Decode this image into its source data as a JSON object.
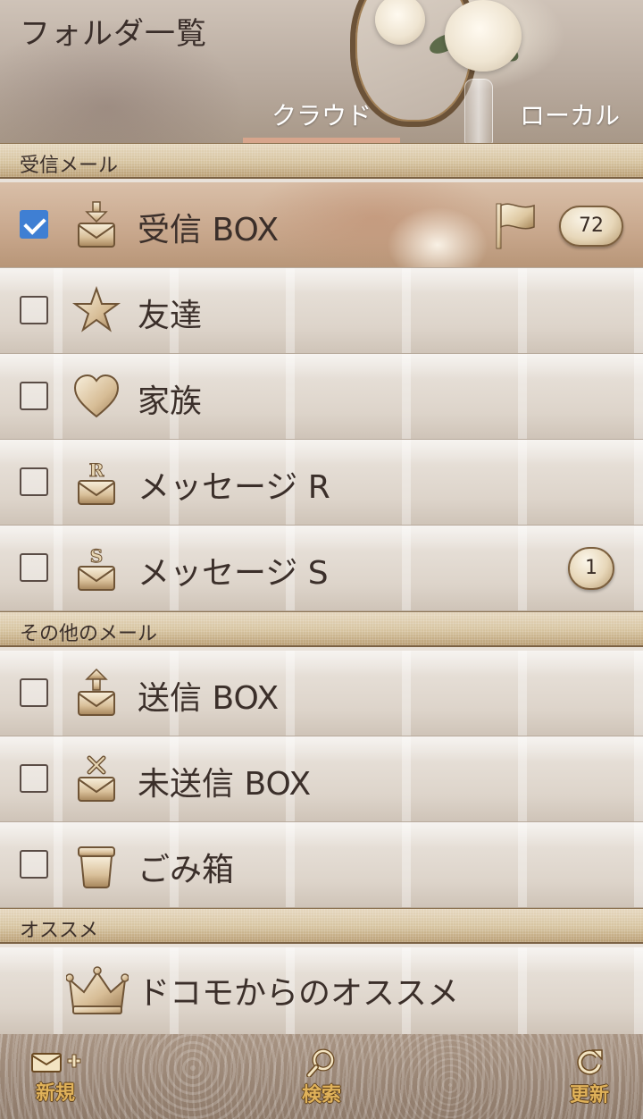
{
  "header": {
    "title": "フォルダ一覧",
    "tabs": [
      {
        "label": "クラウド",
        "selected": true
      },
      {
        "label": "ローカル",
        "selected": false
      }
    ]
  },
  "sections": {
    "received": "受信メール",
    "other": "その他のメール",
    "recommend": "オススメ"
  },
  "folders": [
    {
      "label": "受信 BOX",
      "icon": "mail-download-icon",
      "checked": true,
      "flagged": true,
      "count": "72"
    },
    {
      "label": "友達",
      "icon": "star-icon",
      "checked": false
    },
    {
      "label": "家族",
      "icon": "heart-icon",
      "checked": false
    },
    {
      "label": "メッセージ R",
      "icon": "mail-r-icon",
      "checked": false
    },
    {
      "label": "メッセージ S",
      "icon": "mail-s-icon",
      "checked": false,
      "count": "1"
    },
    {
      "label": "送信 BOX",
      "icon": "mail-upload-icon",
      "checked": false
    },
    {
      "label": "未送信 BOX",
      "icon": "mail-unsent-icon",
      "checked": false
    },
    {
      "label": "ごみ箱",
      "icon": "trash-icon",
      "checked": false
    },
    {
      "label": "ドコモからのオススメ",
      "icon": "crown-icon"
    }
  ],
  "toolbar": {
    "new_label": "新規",
    "search_label": "検索",
    "refresh_label": "更新"
  },
  "colors": {
    "checkbox_checked": "#3f7fd3",
    "tab_underline": "#d7a58c",
    "toolbar_label": "#e0b25a"
  }
}
